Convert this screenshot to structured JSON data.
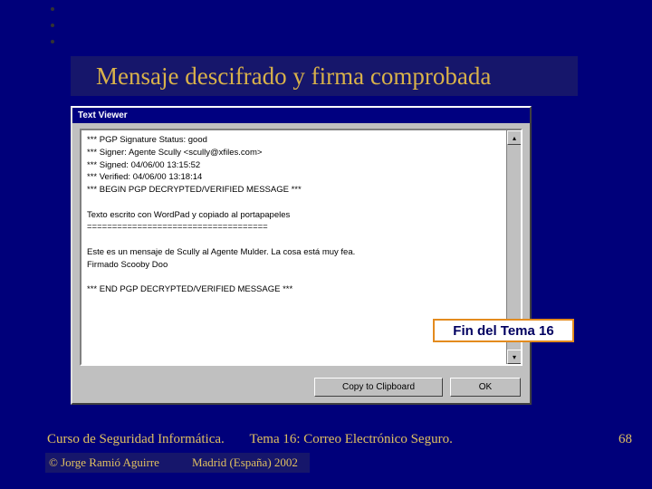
{
  "slide": {
    "title": "Mensaje descifrado y firma comprobada",
    "end_box": "Fin del Tema 16",
    "page_number": "68"
  },
  "window": {
    "title": "Text Viewer",
    "buttons": {
      "copy": "Copy to Clipboard",
      "ok": "OK"
    },
    "message_lines": [
      "*** PGP Signature Status: good",
      "*** Signer: Agente Scully <scully@xfiles.com>",
      "*** Signed: 04/06/00 13:15:52",
      "*** Verified: 04/06/00 13:18:14",
      "*** BEGIN PGP DECRYPTED/VERIFIED MESSAGE ***",
      "",
      "Texto escrito con WordPad y copiado al portapapeles",
      "====================================",
      "",
      "Este es un mensaje de Scully al Agente Mulder. La cosa está muy fea.",
      "Firmado Scooby Doo",
      "",
      "*** END PGP DECRYPTED/VERIFIED MESSAGE ***"
    ]
  },
  "footer": {
    "course": "Curso de Seguridad Informática.",
    "topic": "Tema 16:  Correo Electrónico Seguro.",
    "copyright": "© Jorge Ramió Aguirre",
    "location": "Madrid (España) 2002"
  }
}
